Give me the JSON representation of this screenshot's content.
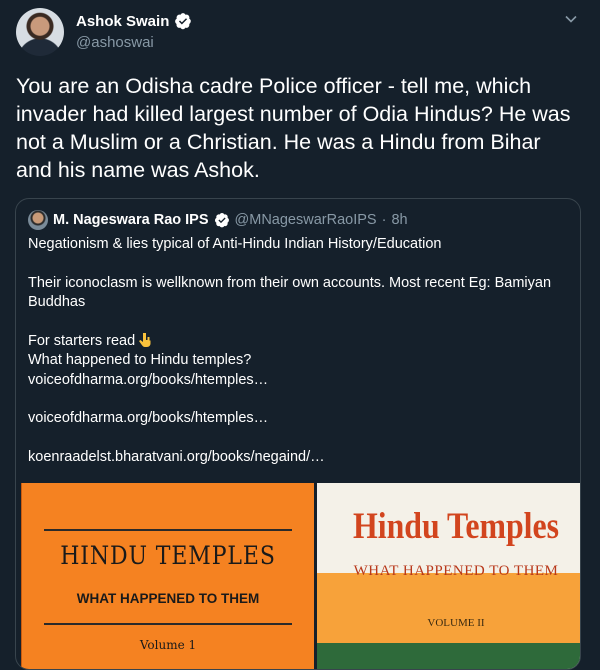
{
  "tweet": {
    "author_name": "Ashok Swain",
    "author_handle": "@ashoswai",
    "text": "You are an Odisha cadre Police officer - tell me, which invader had killed largest number of Odia Hindus? He was not a Muslim or a Christian. He was a Hindu from Bihar and his name was Ashok."
  },
  "quoted": {
    "author_name": "M. Nageswara Rao IPS",
    "author_handle": "@MNageswarRaoIPS",
    "separator": "·",
    "time": "8h",
    "line1": "Negationism & lies typical of Anti-Hindu Indian History/Education",
    "line2": "Their iconoclasm is wellknown from their own accounts. Most recent Eg: Bamiyan Buddhas",
    "line3": "For starters read",
    "line4": "What happened to Hindu temples?",
    "link1": "voiceofdharma.org/books/htemples…",
    "link2": "voiceofdharma.org/books/htemples…",
    "link3": "koenraadelst.bharatvani.org/books/negaind/…"
  },
  "images": {
    "book1": {
      "title": "HINDU TEMPLES",
      "subtitle": "WHAT HAPPENED TO THEM",
      "volume": "Volume  1"
    },
    "book2": {
      "title": "Hindu Temples",
      "subtitle": "WHAT HAPPENED TO THEM",
      "volume": "VOLUME II"
    }
  },
  "colors": {
    "background": "#15202b",
    "muted": "#8899a6",
    "verified": "#ffffff",
    "border": "#38444d"
  },
  "icons": [
    "verified-badge-icon",
    "caret-down-icon",
    "pointing-down-hand-icon"
  ]
}
